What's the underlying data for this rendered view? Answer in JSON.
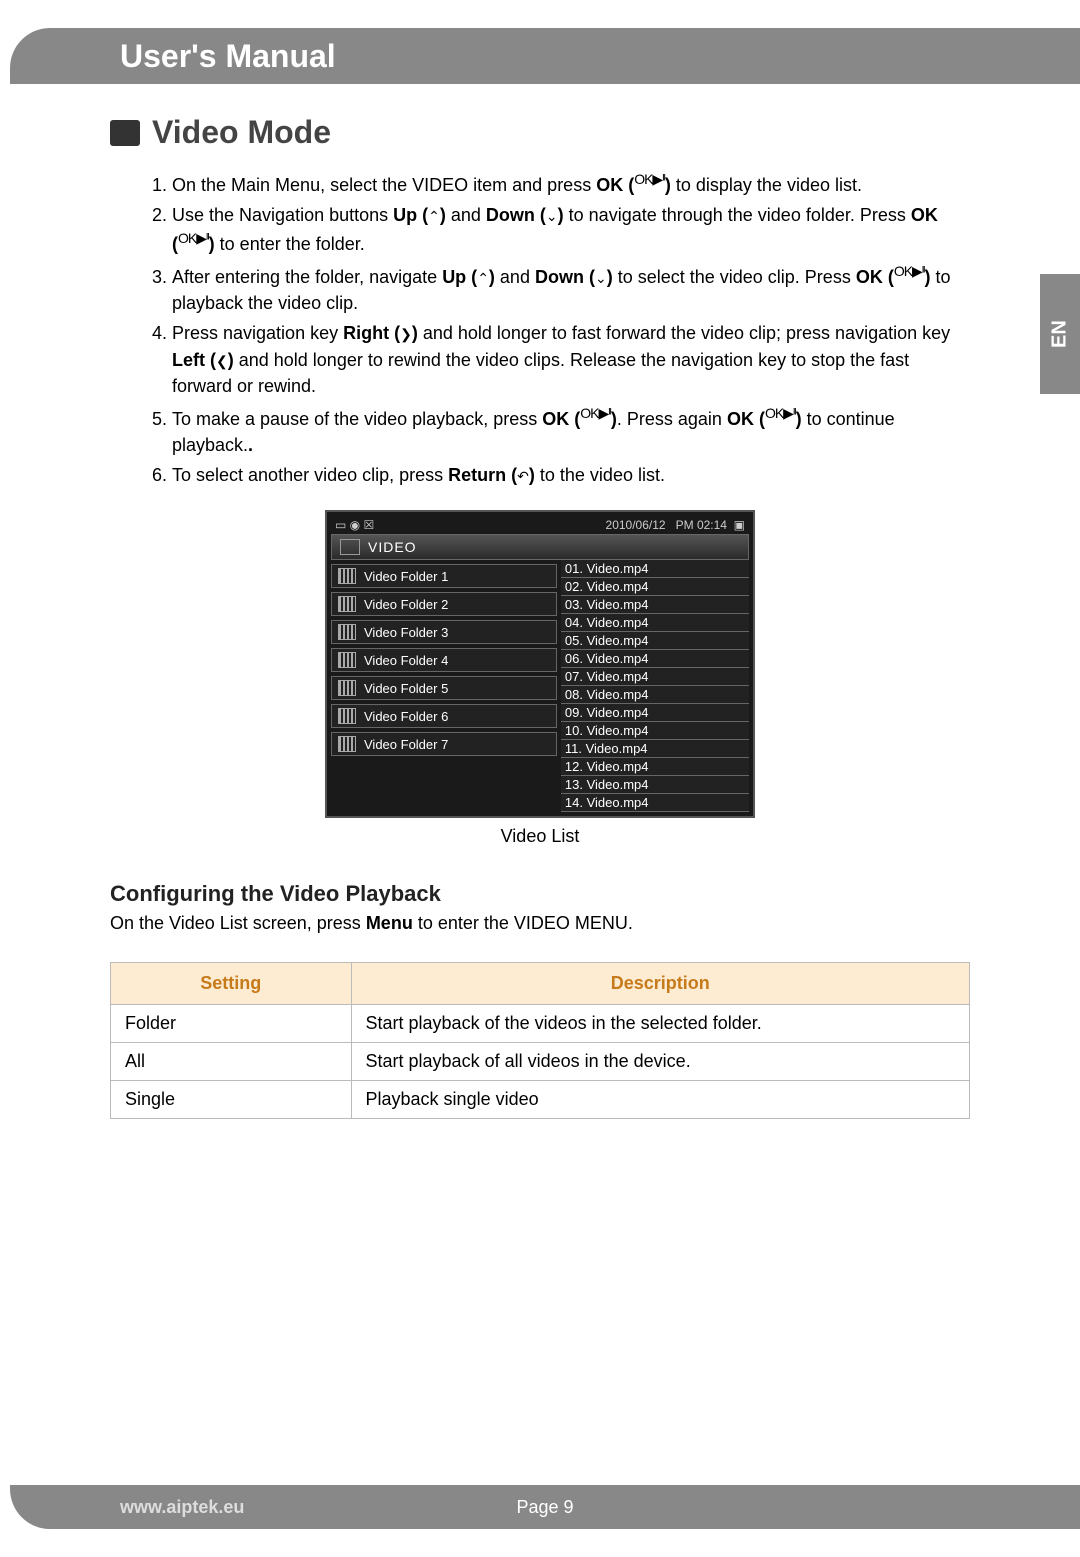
{
  "header": {
    "title": "User's Manual"
  },
  "side_tab": "EN",
  "section": {
    "title": "Video Mode"
  },
  "instructions": [
    {
      "pre": "On the Main Menu, select the VIDEO item and press ",
      "b1": "OK (",
      "sym1": "OK▶ᴵᴵ",
      "b1c": ")",
      "post": " to display the video list."
    },
    {
      "pre": "Use the Navigation buttons ",
      "b1": "Up (",
      "sym1": "⌃",
      "b1c": ")",
      "mid": " and ",
      "b2": "Down (",
      "sym2": "⌄",
      "b2c": ")",
      "mid2": " to navigate through the video folder. Press ",
      "b3": "OK (",
      "sym3": "OK▶ᴵᴵ",
      "b3c": ")",
      "post": " to enter the folder."
    },
    {
      "pre": "After entering the folder, navigate ",
      "b1": "Up (",
      "sym1": "⌃",
      "b1c": ")",
      "mid": " and ",
      "b2": "Down (",
      "sym2": "⌄",
      "b2c": ")",
      "mid2": " to select the video clip. Press ",
      "b3": "OK (",
      "sym3": "OK▶ᴵᴵ",
      "b3c": ")",
      "post": " to playback the video clip."
    },
    {
      "pre": "Press navigation key ",
      "b1": "Right (",
      "sym1": "❯",
      "b1c": ")",
      "mid": " and hold longer to fast forward the video clip; press navigation key ",
      "b2": "Left (",
      "sym2": "❮",
      "b2c": ")",
      "post": " and hold longer to rewind the video clips. Release the navigation key to stop the fast forward or rewind."
    },
    {
      "pre": "To make a pause of the video playback, press ",
      "b1": "OK (",
      "sym1": "OK▶ᴵᴵ",
      "b1c": ")",
      "mid": ". Press again ",
      "b2": "OK (",
      "sym2": "OK▶ᴵᴵ",
      "b2c": ")",
      "post": " to continue playback."
    },
    {
      "pre": "To select another video clip, press ",
      "b1": "Return (",
      "sym1": "↶",
      "b1c": ")",
      "post": " to the video list."
    }
  ],
  "device": {
    "status_left": "▭ ◉ ☒",
    "date": "2010/06/12",
    "time": "PM 02:14",
    "battery": "▣",
    "header_label": "VIDEO",
    "folders": [
      "Video Folder 1",
      "Video Folder 2",
      "Video Folder 3",
      "Video Folder 4",
      "Video Folder 5",
      "Video Folder 6",
      "Video Folder 7"
    ],
    "files": [
      "01. Video.mp4",
      "02. Video.mp4",
      "03. Video.mp4",
      "04. Video.mp4",
      "05. Video.mp4",
      "06. Video.mp4",
      "07. Video.mp4",
      "08. Video.mp4",
      "09. Video.mp4",
      "10. Video.mp4",
      "11. Video.mp4",
      "12. Video.mp4",
      "13. Video.mp4",
      "14. Video.mp4"
    ],
    "caption": "Video List"
  },
  "sub": {
    "heading": "Configuring the Video Playback",
    "text_pre": "On the Video List screen, press ",
    "text_bold": "Menu",
    "text_post": " to enter the VIDEO MENU."
  },
  "table": {
    "headers": [
      "Setting",
      "Description"
    ],
    "rows": [
      [
        "Folder",
        "Start playback of the videos in the selected folder."
      ],
      [
        "All",
        "Start playback of all videos in the device."
      ],
      [
        "Single",
        "Playback single video"
      ]
    ]
  },
  "footer": {
    "url": "www.aiptek.eu",
    "page_label": "Page",
    "page_num": "9"
  }
}
